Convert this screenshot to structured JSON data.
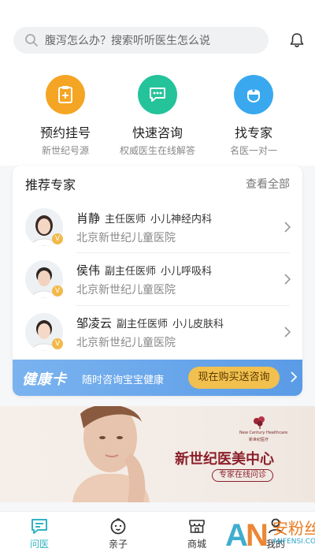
{
  "search": {
    "placeholder": "腹泻怎么办？搜索听听医生怎么说"
  },
  "quick_actions": [
    {
      "title": "预约挂号",
      "subtitle": "新世纪号源",
      "icon": "appointment-icon",
      "color": "#f5a524"
    },
    {
      "title": "快速咨询",
      "subtitle": "权威医生在线解答",
      "icon": "chat-icon",
      "color": "#25c39a"
    },
    {
      "title": "找专家",
      "subtitle": "名医一对一",
      "icon": "nurse-icon",
      "color": "#39a8ef"
    }
  ],
  "experts": {
    "heading": "推荐专家",
    "more": "查看全部",
    "items": [
      {
        "name": "肖静",
        "title": "主任医师",
        "dept": "小儿神经内科",
        "hospital": "北京新世纪儿童医院"
      },
      {
        "name": "侯伟",
        "title": "副主任医师",
        "dept": "小儿呼吸科",
        "hospital": "北京新世纪儿童医院"
      },
      {
        "name": "邹凌云",
        "title": "副主任医师",
        "dept": "小儿皮肤科",
        "hospital": "北京新世纪儿童医院"
      }
    ],
    "badge": "V"
  },
  "health_card": {
    "logo": "健康卡",
    "slogan": "随时咨询宝宝健康",
    "cta": "现在购买送咨询"
  },
  "banner": {
    "brand_en": "New Century Healthcare",
    "brand_cn": "新世纪医疗",
    "headline": "新世纪医美中心",
    "pill": "专家在线问诊"
  },
  "nav": [
    {
      "label": "问医",
      "icon": "chat-bubble-icon",
      "active": true
    },
    {
      "label": "亲子",
      "icon": "baby-face-icon",
      "active": false
    },
    {
      "label": "商城",
      "icon": "store-icon",
      "active": false
    },
    {
      "label": "我的",
      "icon": "profile-icon",
      "active": false
    }
  ],
  "watermark": {
    "cn": "安粉丝",
    "en": "ANFENSI.COM"
  },
  "colors": {
    "accent": "#30b3c4",
    "cta": "#f2c04e",
    "card_blue": "#5a9be6"
  }
}
